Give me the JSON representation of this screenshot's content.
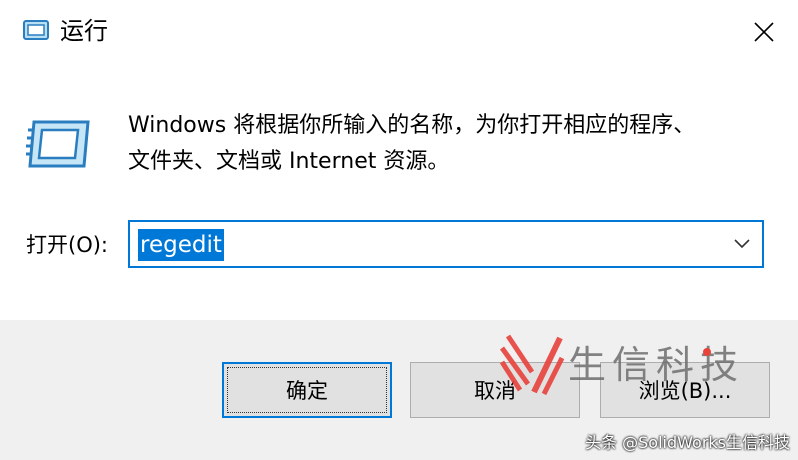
{
  "window": {
    "title": "运行",
    "close_icon": "close-icon"
  },
  "content": {
    "description": "Windows 将根据你所输入的名称，为你打开相应的程序、\n文件夹、文档或 Internet 资源。",
    "open_label": "打开(O):",
    "open_value": "regedit",
    "dropdown_icon": "chevron-down-icon",
    "run_icon": "run-icon"
  },
  "buttons": {
    "ok_label": "确定",
    "cancel_label": "取消",
    "browse_label": "浏览(B)..."
  },
  "watermark": {
    "brand": "生信科技",
    "credit": "头条 @SolidWorks生信科技"
  },
  "colors": {
    "accent": "#0078d7",
    "footer_bg": "#f0f0f0",
    "button_bg": "#e1e1e1",
    "watermark_red": "#e8423b"
  }
}
